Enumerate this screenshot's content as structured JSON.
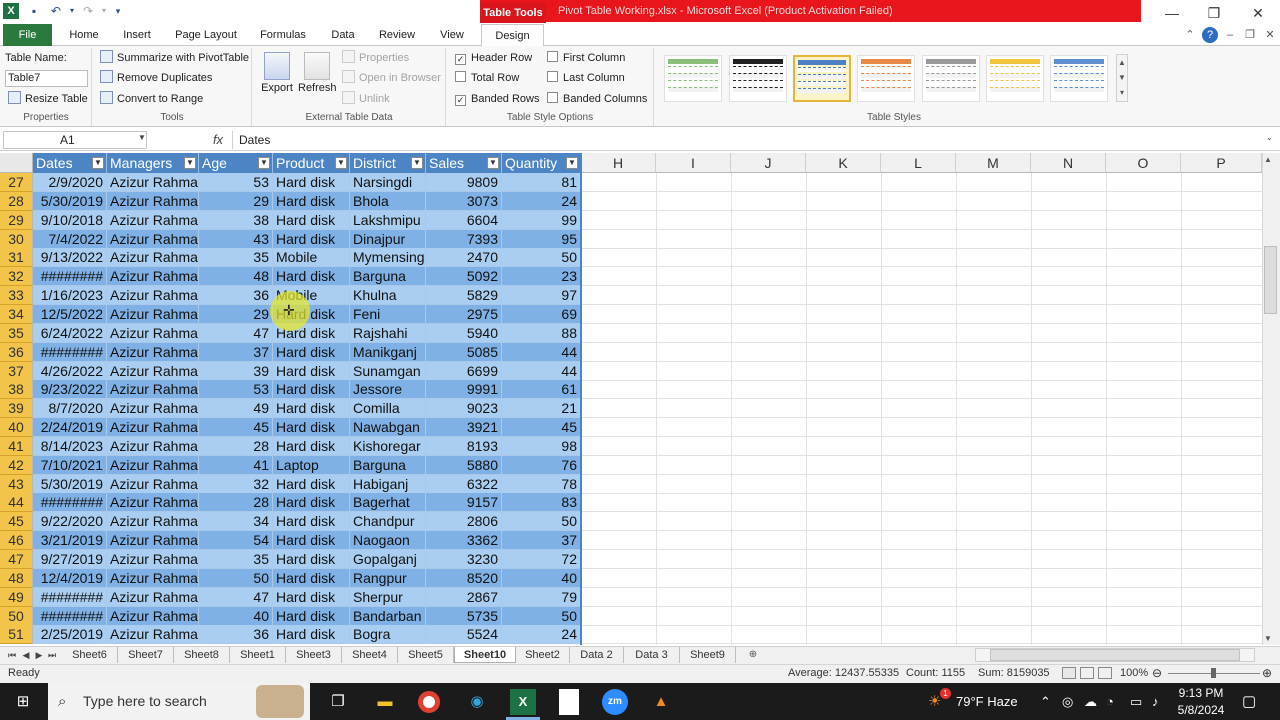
{
  "titlebar": {
    "context_tab": "Table Tools",
    "window_title": "Pivot Table Working.xlsx  -  Microsoft Excel (Product Activation Failed)"
  },
  "ribbon_tabs": [
    "File",
    "Home",
    "Insert",
    "Page Layout",
    "Formulas",
    "Data",
    "Review",
    "View",
    "Design"
  ],
  "properties": {
    "table_name_label": "Table Name:",
    "table_name": "Table7",
    "resize": "Resize Table",
    "group": "Properties"
  },
  "tools": {
    "summarize": "Summarize with PivotTable",
    "remove_dupes": "Remove Duplicates",
    "convert": "Convert to Range",
    "group": "Tools"
  },
  "external": {
    "export": "Export",
    "refresh": "Refresh",
    "properties": "Properties",
    "open_browser": "Open in Browser",
    "unlink": "Unlink",
    "group": "External Table Data"
  },
  "style_options": {
    "header_row": "Header Row",
    "total_row": "Total Row",
    "banded_rows": "Banded Rows",
    "first_column": "First Column",
    "last_column": "Last Column",
    "banded_columns": "Banded Columns",
    "header_row_checked": true,
    "total_row_checked": false,
    "banded_rows_checked": true,
    "first_column_checked": false,
    "last_column_checked": false,
    "banded_columns_checked": false,
    "group": "Table Style Options"
  },
  "table_styles": {
    "group": "Table Styles",
    "swatch_colors": [
      "#8cbf7a",
      "#222222",
      "#4d7fc4",
      "#e8894a",
      "#9a9a9a",
      "#f0c33c",
      "#5b8fd0"
    ]
  },
  "formula_bar": {
    "name_box": "A1",
    "fx": "fx",
    "value": "Dates"
  },
  "columns": {
    "table_headers": [
      "Dates",
      "Managers",
      "Age",
      "Product",
      "District",
      "Sales",
      "Quantity"
    ],
    "other_headers": [
      "H",
      "I",
      "J",
      "K",
      "L",
      "M",
      "N",
      "O",
      "P"
    ]
  },
  "rows": [
    {
      "n": "27",
      "date": "2/9/2020",
      "mgr": "Azizur Rahma",
      "age": "53",
      "prod": "Hard disk",
      "dist": "Narsingdi",
      "sales": "9809",
      "qty": "81"
    },
    {
      "n": "28",
      "date": "5/30/2019",
      "mgr": "Azizur Rahma",
      "age": "29",
      "prod": "Hard disk",
      "dist": "Bhola",
      "sales": "3073",
      "qty": "24"
    },
    {
      "n": "29",
      "date": "9/10/2018",
      "mgr": "Azizur Rahma",
      "age": "38",
      "prod": "Hard disk",
      "dist": "Lakshmipu",
      "sales": "6604",
      "qty": "99"
    },
    {
      "n": "30",
      "date": "7/4/2022",
      "mgr": "Azizur Rahma",
      "age": "43",
      "prod": "Hard disk",
      "dist": "Dinajpur",
      "sales": "7393",
      "qty": "95"
    },
    {
      "n": "31",
      "date": "9/13/2022",
      "mgr": "Azizur Rahma",
      "age": "35",
      "prod": "Mobile",
      "dist": "Mymensing",
      "sales": "2470",
      "qty": "50"
    },
    {
      "n": "32",
      "date": "########",
      "mgr": "Azizur Rahma",
      "age": "48",
      "prod": "Hard disk",
      "dist": "Barguna",
      "sales": "5092",
      "qty": "23"
    },
    {
      "n": "33",
      "date": "1/16/2023",
      "mgr": "Azizur Rahma",
      "age": "36",
      "prod": "Mobile",
      "dist": "Khulna",
      "sales": "5829",
      "qty": "97"
    },
    {
      "n": "34",
      "date": "12/5/2022",
      "mgr": "Azizur Rahma",
      "age": "29",
      "prod": "Hard disk",
      "dist": "Feni",
      "sales": "2975",
      "qty": "69"
    },
    {
      "n": "35",
      "date": "6/24/2022",
      "mgr": "Azizur Rahma",
      "age": "47",
      "prod": "Hard disk",
      "dist": "Rajshahi",
      "sales": "5940",
      "qty": "88"
    },
    {
      "n": "36",
      "date": "########",
      "mgr": "Azizur Rahma",
      "age": "37",
      "prod": "Hard disk",
      "dist": "Manikganj",
      "sales": "5085",
      "qty": "44"
    },
    {
      "n": "37",
      "date": "4/26/2022",
      "mgr": "Azizur Rahma",
      "age": "39",
      "prod": "Hard disk",
      "dist": "Sunamgan",
      "sales": "6699",
      "qty": "44"
    },
    {
      "n": "38",
      "date": "9/23/2022",
      "mgr": "Azizur Rahma",
      "age": "53",
      "prod": "Hard disk",
      "dist": "Jessore",
      "sales": "9991",
      "qty": "61"
    },
    {
      "n": "39",
      "date": "8/7/2020",
      "mgr": "Azizur Rahma",
      "age": "49",
      "prod": "Hard disk",
      "dist": "Comilla",
      "sales": "9023",
      "qty": "21"
    },
    {
      "n": "40",
      "date": "2/24/2019",
      "mgr": "Azizur Rahma",
      "age": "45",
      "prod": "Hard disk",
      "dist": "Nawabgan",
      "sales": "3921",
      "qty": "45"
    },
    {
      "n": "41",
      "date": "8/14/2023",
      "mgr": "Azizur Rahma",
      "age": "28",
      "prod": "Hard disk",
      "dist": "Kishoregar",
      "sales": "8193",
      "qty": "98"
    },
    {
      "n": "42",
      "date": "7/10/2021",
      "mgr": "Azizur Rahma",
      "age": "41",
      "prod": "Laptop",
      "dist": "Barguna",
      "sales": "5880",
      "qty": "76"
    },
    {
      "n": "43",
      "date": "5/30/2019",
      "mgr": "Azizur Rahma",
      "age": "32",
      "prod": "Hard disk",
      "dist": "Habiganj",
      "sales": "6322",
      "qty": "78"
    },
    {
      "n": "44",
      "date": "########",
      "mgr": "Azizur Rahma",
      "age": "28",
      "prod": "Hard disk",
      "dist": "Bagerhat",
      "sales": "9157",
      "qty": "83"
    },
    {
      "n": "45",
      "date": "9/22/2020",
      "mgr": "Azizur Rahma",
      "age": "34",
      "prod": "Hard disk",
      "dist": "Chandpur",
      "sales": "2806",
      "qty": "50"
    },
    {
      "n": "46",
      "date": "3/21/2019",
      "mgr": "Azizur Rahma",
      "age": "54",
      "prod": "Hard disk",
      "dist": "Naogaon",
      "sales": "3362",
      "qty": "37"
    },
    {
      "n": "47",
      "date": "9/27/2019",
      "mgr": "Azizur Rahma",
      "age": "35",
      "prod": "Hard disk",
      "dist": "Gopalganj",
      "sales": "3230",
      "qty": "72"
    },
    {
      "n": "48",
      "date": "12/4/2019",
      "mgr": "Azizur Rahma",
      "age": "50",
      "prod": "Hard disk",
      "dist": "Rangpur",
      "sales": "8520",
      "qty": "40"
    },
    {
      "n": "49",
      "date": "########",
      "mgr": "Azizur Rahma",
      "age": "47",
      "prod": "Hard disk",
      "dist": "Sherpur",
      "sales": "2867",
      "qty": "79"
    },
    {
      "n": "50",
      "date": "########",
      "mgr": "Azizur Rahma",
      "age": "40",
      "prod": "Hard disk",
      "dist": "Bandarban",
      "sales": "5735",
      "qty": "50"
    },
    {
      "n": "51",
      "date": "2/25/2019",
      "mgr": "Azizur Rahma",
      "age": "36",
      "prod": "Hard disk",
      "dist": "Bogra",
      "sales": "5524",
      "qty": "24"
    }
  ],
  "sheet_tabs": [
    "Sheet6",
    "Sheet7",
    "Sheet8",
    "Sheet1",
    "Sheet3",
    "Sheet4",
    "Sheet5",
    "Sheet10",
    "Sheet2",
    "Data 2",
    "Data 3",
    "Sheet9"
  ],
  "active_sheet": "Sheet10",
  "status": {
    "ready": "Ready",
    "average": "Average: 12437.55335",
    "count": "Count: 1155",
    "sum": "Sum: 8159035",
    "zoom": "100%"
  },
  "taskbar": {
    "search_placeholder": "Type here to search",
    "weather": "79°F  Haze",
    "time": "9:13 PM",
    "date": "5/8/2024",
    "notification_count": "1"
  },
  "colors": {
    "table_header": "#4d85c4",
    "band_light": "#a9cef1",
    "band_dark": "#7fb1e6",
    "excel_green": "#2b7a3d",
    "title_red": "#e8161c",
    "row_header": "#f3c44a"
  }
}
